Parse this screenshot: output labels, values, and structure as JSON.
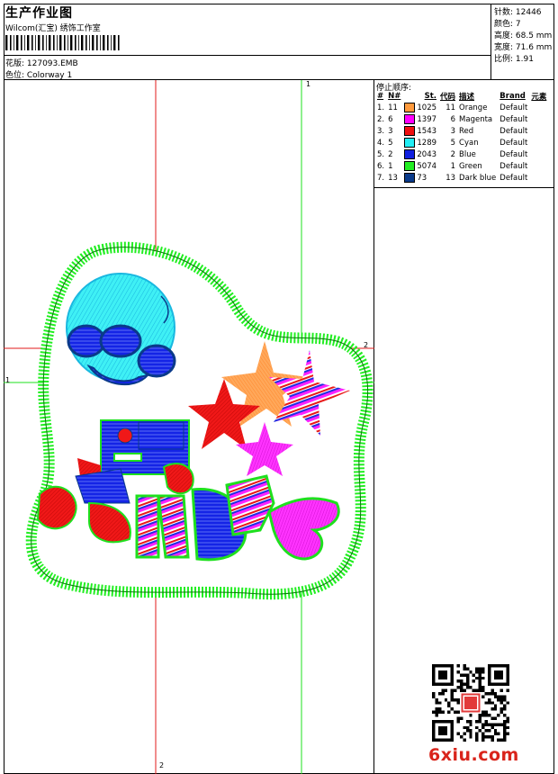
{
  "header": {
    "title": "生产作业图",
    "company": "Wilcom(汇宝) 绣饰工作室",
    "pattern_label": "花版: 127093.EMB",
    "colorway_label": "色位: Colorway 1"
  },
  "stats": {
    "stitches": "针数: 12446",
    "colors": "颜色: 7",
    "height": "高度: 68.5 mm",
    "width": "宽度: 71.6 mm",
    "scale": "比例: 1.91"
  },
  "stop_sequence": {
    "title": "停止顺序:",
    "headers": [
      "#",
      "N#",
      "St.",
      "代码",
      "描述",
      "Brand",
      "元素"
    ],
    "rows": [
      {
        "num": "1.",
        "needle": "11",
        "color": "#FF9A3C",
        "stitches": "1025",
        "code": "11",
        "desc": "Orange",
        "brand": "Default"
      },
      {
        "num": "2.",
        "needle": "6",
        "color": "#FF00FF",
        "stitches": "1397",
        "code": "6",
        "desc": "Magenta",
        "brand": "Default"
      },
      {
        "num": "3.",
        "needle": "3",
        "color": "#F01010",
        "stitches": "1543",
        "code": "3",
        "desc": "Red",
        "brand": "Default"
      },
      {
        "num": "4.",
        "needle": "5",
        "color": "#22EEF5",
        "stitches": "1289",
        "code": "5",
        "desc": "Cyan",
        "brand": "Default"
      },
      {
        "num": "5.",
        "needle": "2",
        "color": "#1020E0",
        "stitches": "2043",
        "code": "2",
        "desc": "Blue",
        "brand": "Default"
      },
      {
        "num": "6.",
        "needle": "1",
        "color": "#22EE22",
        "stitches": "5074",
        "code": "1",
        "desc": "Green",
        "brand": "Default"
      },
      {
        "num": "7.",
        "needle": "13",
        "color": "#0A3A8A",
        "stitches": "73",
        "code": "13",
        "desc": "Dark blue",
        "brand": "Default"
      }
    ]
  },
  "guides": {
    "v1": "1",
    "v2": "2",
    "h1": "1",
    "h2": "2"
  },
  "watermark": "6xiu.com",
  "icons": {
    "qr": "qr-code-icon",
    "seal": "red-seal-icon"
  }
}
